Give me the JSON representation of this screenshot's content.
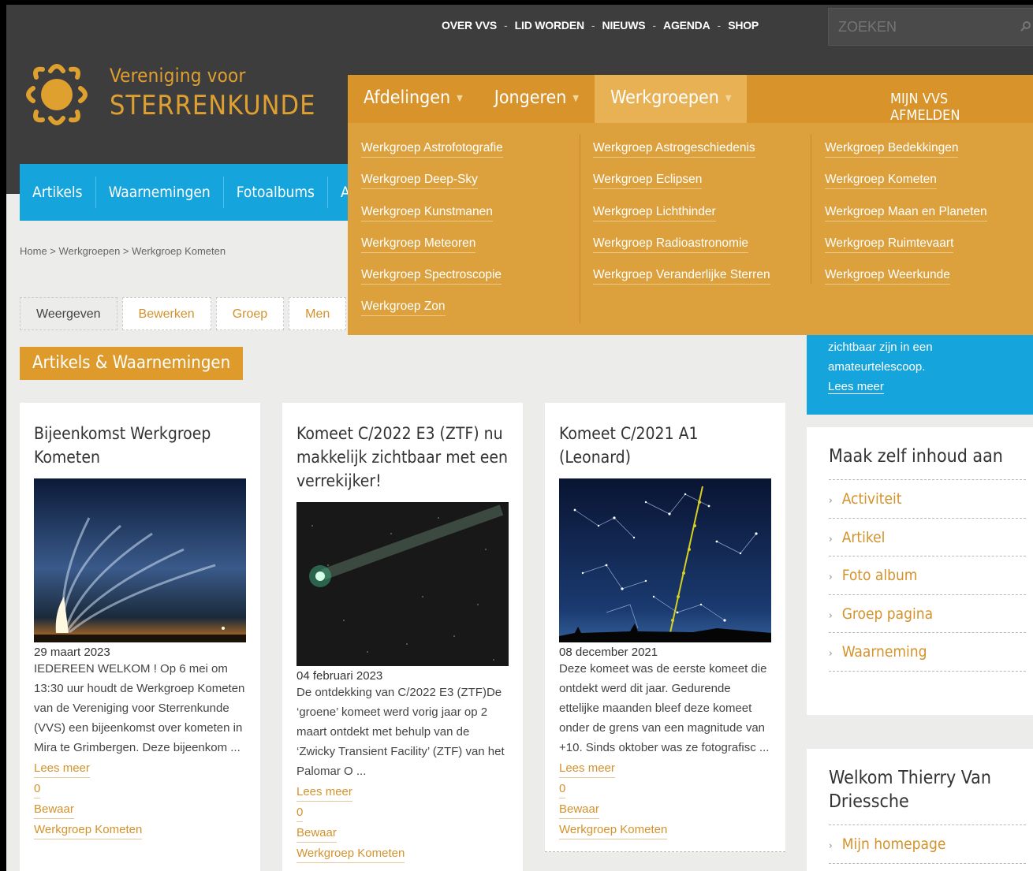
{
  "topnav": {
    "items": [
      "OVER VVS",
      "LID WORDEN",
      "NIEUWS",
      "AGENDA",
      "SHOP"
    ],
    "search_placeholder": "ZOEKEN"
  },
  "brand": {
    "line1": "Vereniging voor",
    "line2": "STERRENKUNDE"
  },
  "bluenav": {
    "items": [
      "Artikels",
      "Waarnemingen",
      "Fotoalbums",
      "A"
    ]
  },
  "breadcrumb": "Home > Werkgroepen > Werkgroep Kometen",
  "tabs": [
    "Weergeven",
    "Bewerken",
    "Groep",
    "Men"
  ],
  "section_title": "Artikels & Waarnemingen",
  "megamenu": {
    "top": [
      "Afdelingen",
      "Jongeren",
      "Werkgroepen"
    ],
    "right": [
      "MIJN VVS",
      "AFMELDEN"
    ],
    "col1": [
      "Werkgroep Astrofotografie",
      "Werkgroep Deep-Sky",
      "Werkgroep Kunstmanen",
      "Werkgroep Meteoren",
      "Werkgroep Spectroscopie",
      "Werkgroep Zon"
    ],
    "col2": [
      "Werkgroep Astrogeschiedenis",
      "Werkgroep Eclipsen",
      "Werkgroep Lichthinder",
      "Werkgroep Radioastronomie",
      "Werkgroep Veranderlijke Sterren"
    ],
    "col3": [
      "Werkgroep Bedekkingen",
      "Werkgroep Kometen",
      "Werkgroep Maan en Planeten",
      "Werkgroep Ruimtevaart",
      "Werkgroep Weerkunde"
    ]
  },
  "cards": [
    {
      "title": "Bijeenkomst Werkgroep Kometen",
      "date": "29 maart 2023",
      "desc": "IEDEREEN WELKOM ! Op 6 mei om 13:30 uur houdt de Werkgroep Kometen van de Vereniging voor Sterrenkunde (VVS) een bijeenkomst over kometen in Mira te Grimbergen. Deze bijeenkom ...",
      "read": "Lees meer",
      "count": "0",
      "save": "Bewaar",
      "group": "Werkgroep Kometen"
    },
    {
      "title": "Komeet C/2022 E3 (ZTF) nu makkelijk zichtbaar met een verrekijker!",
      "date": "04 februari 2023",
      "desc": "De ontdekking van C/2022 E3 (ZTF)De ‘groene’ komeet werd vorig jaar op 2 maart ontdekt met behulp van de ‘Zwicky Transient Facility’ (ZTF) van het Palomar O ...",
      "read": "Lees meer",
      "count": "0",
      "save": "Bewaar",
      "group": "Werkgroep Kometen"
    },
    {
      "title": "Komeet C/2021 A1 (Leonard)",
      "date": "08 december 2021",
      "desc": "Deze komeet was de eerste komeet die ontdekt werd dit jaar. Gedurende ettelijke maanden bleef deze komeet onder de grens van een magnitude van +10. Sinds oktober was ze fotografisc ...",
      "read": "Lees meer",
      "count": "0",
      "save": "Bewaar",
      "group": "Werkgroep Kometen"
    }
  ],
  "bluebox": {
    "text": "zichtbaar zijn in een amateurtelescoop.",
    "link": "Lees meer"
  },
  "create": {
    "title": "Maak zelf inhoud aan",
    "items": [
      "Activiteit",
      "Artikel",
      "Foto album",
      "Groep pagina",
      "Waarneming"
    ]
  },
  "welcome": {
    "title": "Welkom Thierry Van Driessche",
    "items": [
      "Mijn homepage"
    ]
  },
  "colors": {
    "orange": "#dca13c",
    "blue": "#16a4dc",
    "header": "#3d3d3d"
  }
}
